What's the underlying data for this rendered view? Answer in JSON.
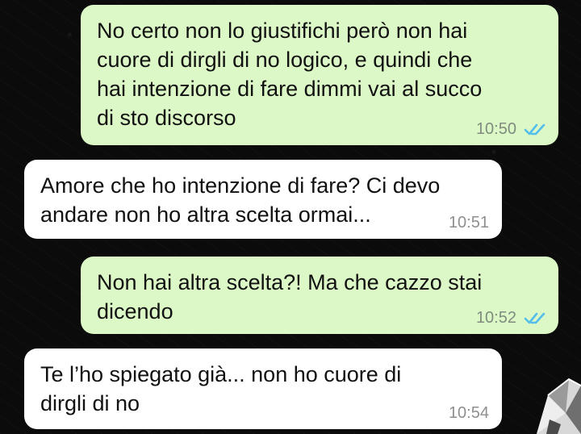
{
  "colors": {
    "background": "#0b0b0b",
    "sent_bubble": "#dcf8c6",
    "received_bubble": "#ffffff",
    "read_ticks": "#53bdeb"
  },
  "messages": [
    {
      "direction": "sent",
      "text": "No certo non lo giustifichi però non hai\ncuore di dirgli di no logico, e quindi che\nhai intenzione di fare dimmi vai al succo\ndi sto discorso",
      "time": "10:50",
      "status_icon": "double-check-read-icon"
    },
    {
      "direction": "received",
      "text": "Amore che ho intenzione di fare? Ci devo\nandare non ho altra scelta ormai...",
      "time": "10:51"
    },
    {
      "direction": "sent",
      "text": "Non hai altra scelta?! Ma che cazzo stai\ndicendo",
      "time": "10:52",
      "status_icon": "double-check-read-icon"
    },
    {
      "direction": "received",
      "text": "Te l’ho spiegato già... non ho cuore di\ndirgli di no",
      "time": "10:54"
    }
  ],
  "decorations": {
    "wallpaper_icon": "doodle-pattern-icon",
    "sticker_icon": "crystal-sticker-icon"
  }
}
